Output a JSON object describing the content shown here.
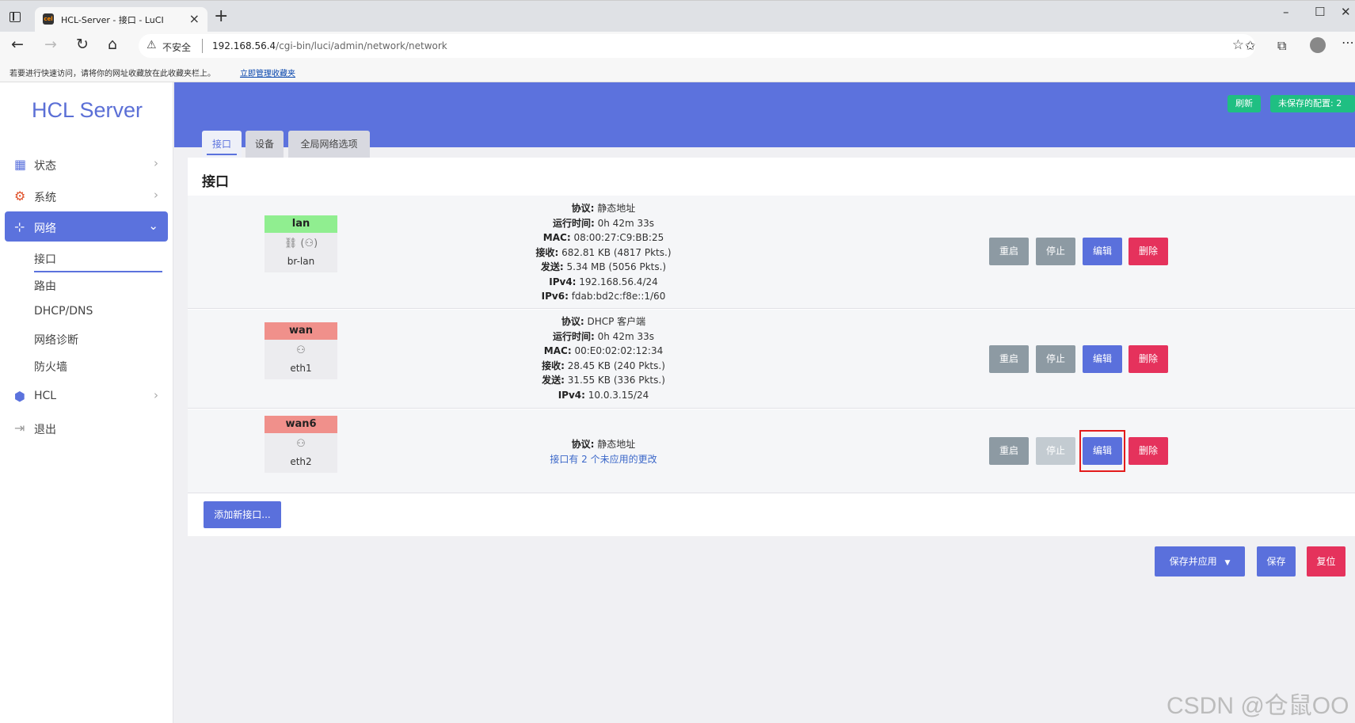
{
  "browser": {
    "tab_title": "HCL-Server - 接口 - LuCI",
    "favicon_text": "cel",
    "insecure_label": "不安全",
    "url_host": "192.168.56.4",
    "url_path": "/cgi-bin/luci/admin/network/network",
    "favorites_hint": "若要进行快速访问，请将你的网址收藏放在此收藏夹栏上。",
    "favorites_link": "立即管理收藏夹"
  },
  "sidebar": {
    "brand": "HCL Server",
    "items": [
      {
        "label": "状态",
        "icon": "dashboard-icon"
      },
      {
        "label": "系统",
        "icon": "gear-icon"
      },
      {
        "label": "网络",
        "icon": "network-icon"
      },
      {
        "label": "HCL",
        "icon": "cube-icon"
      },
      {
        "label": "退出",
        "icon": "logout-icon"
      }
    ],
    "subitems": [
      "接口",
      "路由",
      "DHCP/DNS",
      "网络诊断",
      "防火墙"
    ]
  },
  "header": {
    "refresh_label": "刷新",
    "unsaved_label": "未保存的配置: 2"
  },
  "page_tabs": [
    "接口",
    "设备",
    "全局网络选项"
  ],
  "section_title": "接口",
  "interfaces": [
    {
      "name": "lan",
      "badge_color": "#90ee90",
      "icon_glyph": "⛓ (⚇)",
      "device": "br-lan",
      "info": [
        {
          "k": "协议:",
          "v": " 静态地址"
        },
        {
          "k": "运行时间:",
          "v": " 0h 42m 33s"
        },
        {
          "k": "MAC:",
          "v": " 08:00:27:C9:BB:25"
        },
        {
          "k": "接收:",
          "v": " 682.81 KB (4817 Pkts.)"
        },
        {
          "k": "发送:",
          "v": " 5.34 MB (5056 Pkts.)"
        },
        {
          "k": "IPv4:",
          "v": " 192.168.56.4/24"
        },
        {
          "k": "IPv6:",
          "v": " fdab:bd2c:f8e::1/60"
        }
      ]
    },
    {
      "name": "wan",
      "badge_color": "#f0908b",
      "icon_glyph": "⚇",
      "device": "eth1",
      "info": [
        {
          "k": "协议:",
          "v": " DHCP 客户端"
        },
        {
          "k": "运行时间:",
          "v": " 0h 42m 33s"
        },
        {
          "k": "MAC:",
          "v": " 00:E0:02:02:12:34"
        },
        {
          "k": "接收:",
          "v": " 28.45 KB (240 Pkts.)"
        },
        {
          "k": "发送:",
          "v": " 31.55 KB (336 Pkts.)"
        },
        {
          "k": "IPv4:",
          "v": " 10.0.3.15/24"
        }
      ]
    },
    {
      "name": "wan6",
      "badge_color": "#f0908b",
      "icon_glyph": "⚇",
      "device": "eth2",
      "info": [
        {
          "k": "协议:",
          "v": " 静态地址"
        }
      ],
      "pending_changes": "接口有 2 个未应用的更改"
    }
  ],
  "actions": {
    "restart": "重启",
    "stop": "停止",
    "edit": "编辑",
    "delete": "删除"
  },
  "add_interface_label": "添加新接口...",
  "footer": {
    "save_apply": "保存并应用",
    "save": "保存",
    "reset": "复位"
  },
  "watermark": "CSDN @仓鼠OO"
}
